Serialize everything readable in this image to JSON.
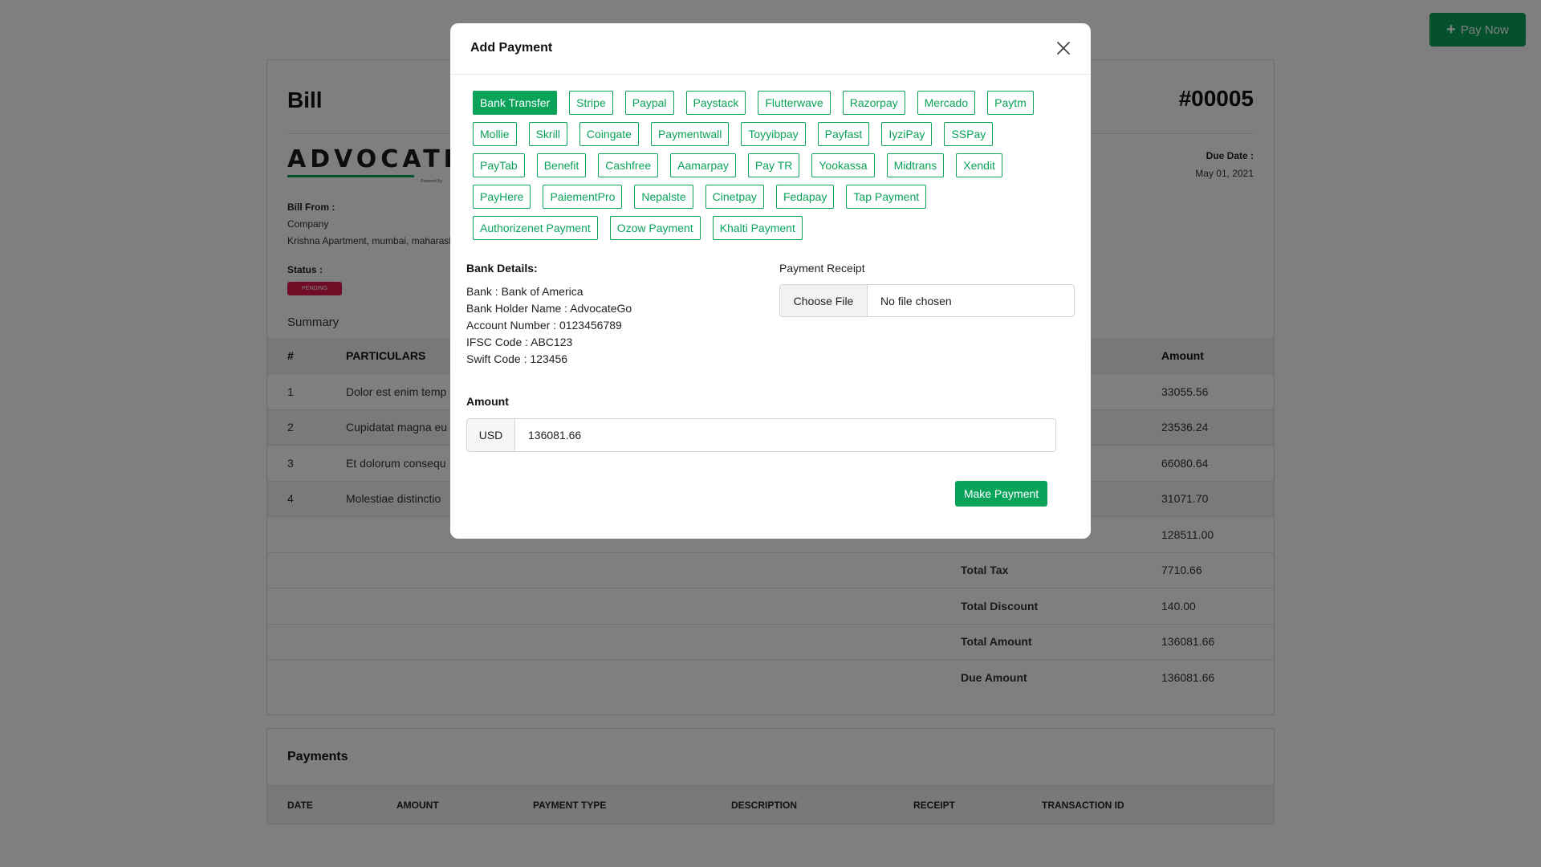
{
  "topbar": {
    "pay_now_label": "Pay Now"
  },
  "bill": {
    "title": "Bill",
    "number": "#00005",
    "logo_text": "ADVOCATE",
    "logo_tagline": "Powered By",
    "due_date_label": "Due Date :",
    "due_date_value": "May 01, 2021",
    "bill_from_label": "Bill From :",
    "company": "Company",
    "address": "Krishna Apartment, mumbai, maharashtra",
    "status_label": "Status :",
    "status_value": "PENDING",
    "summary_label": "Summary",
    "table": {
      "headers": [
        "#",
        "PARTICULARS",
        "",
        "Amount"
      ],
      "rows": [
        {
          "num": "1",
          "particular": "Dolor est enim temp",
          "amount": "33055.56"
        },
        {
          "num": "2",
          "particular": "Cupidatat magna eu",
          "amount": "23536.24"
        },
        {
          "num": "3",
          "particular": "Et dolorum consequ",
          "amount": "66080.64"
        },
        {
          "num": "4",
          "particular": "Molestiae distinctio",
          "amount": "31071.70"
        }
      ],
      "totals": [
        {
          "label": "",
          "value": "128511.00"
        },
        {
          "label": "Total Tax",
          "value": "7710.66"
        },
        {
          "label": "Total Discount",
          "value": "140.00"
        },
        {
          "label": "Total Amount",
          "value": "136081.66"
        },
        {
          "label": "Due Amount",
          "value": "136081.66"
        }
      ]
    }
  },
  "payments": {
    "title": "Payments",
    "headers": [
      "DATE",
      "AMOUNT",
      "PAYMENT TYPE",
      "DESCRIPTION",
      "RECEIPT",
      "TRANSACTION ID"
    ]
  },
  "modal": {
    "title": "Add Payment",
    "methods": [
      [
        "Bank Transfer",
        "Stripe",
        "Paypal",
        "Paystack",
        "Flutterwave",
        "Razorpay",
        "Mercado",
        "Paytm"
      ],
      [
        "Mollie",
        "Skrill",
        "Coingate",
        "Paymentwall",
        "Toyyibpay",
        "Payfast",
        "IyziPay",
        "SSPay"
      ],
      [
        "PayTab",
        "Benefit",
        "Cashfree",
        "Aamarpay",
        "Pay TR",
        "Yookassa",
        "Midtrans",
        "Xendit"
      ],
      [
        "PayHere",
        "PaiementPro",
        "Nepalste",
        "Cinetpay",
        "Fedapay",
        "Tap Payment"
      ],
      [
        "Authorizenet Payment",
        "Ozow Payment",
        "Khalti Payment"
      ]
    ],
    "active_method": "Bank Transfer",
    "bank_details_title": "Bank Details:",
    "bank_lines": [
      "Bank : Bank of America",
      "Bank Holder Name : AdvocateGo",
      "Account Number : 0123456789",
      "IFSC Code : ABC123",
      "Swift Code : 123456"
    ],
    "receipt_label": "Payment Receipt",
    "choose_file_label": "Choose File",
    "no_file_text": "No file chosen",
    "amount_label": "Amount",
    "currency": "USD",
    "amount_value": "136081.66",
    "submit_label": "Make Payment"
  },
  "colors": {
    "accent": "#0aa35a",
    "status_pending": "#e0194a"
  }
}
